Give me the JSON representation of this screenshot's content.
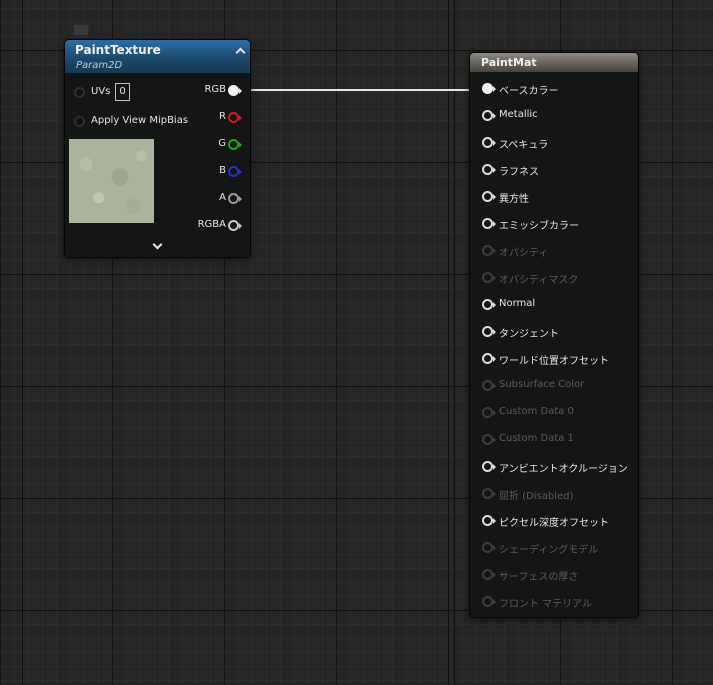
{
  "texture_node": {
    "title": "PaintTexture",
    "subtitle": "Param2D",
    "inputs": {
      "uvs_label": "UVs",
      "uvs_value": "0",
      "mip_label": "Apply View MipBias"
    },
    "outputs": {
      "rgb": "RGB",
      "r": "R",
      "g": "G",
      "b": "B",
      "a": "A",
      "rgba": "RGBA"
    },
    "colors": {
      "r": "#d81818",
      "g": "#1ea41e",
      "b": "#2030d0",
      "a": "#9a9a9a",
      "rgba": "#c8c8c8"
    }
  },
  "material_node": {
    "title": "PaintMat",
    "pins": [
      {
        "label": "ベースカラー",
        "enabled": true
      },
      {
        "label": "Metallic",
        "enabled": true
      },
      {
        "label": "スペキュラ",
        "enabled": true
      },
      {
        "label": "ラフネス",
        "enabled": true
      },
      {
        "label": "異方性",
        "enabled": true
      },
      {
        "label": "エミッシブカラー",
        "enabled": true
      },
      {
        "label": "オパシティ",
        "enabled": false
      },
      {
        "label": "オパシティマスク",
        "enabled": false
      },
      {
        "label": "Normal",
        "enabled": true
      },
      {
        "label": "タンジェント",
        "enabled": true
      },
      {
        "label": "ワールド位置オフセット",
        "enabled": true
      },
      {
        "label": "Subsurface Color",
        "enabled": false
      },
      {
        "label": "Custom Data 0",
        "enabled": false
      },
      {
        "label": "Custom Data 1",
        "enabled": false
      },
      {
        "label": "アンビエントオクルージョン",
        "enabled": true
      },
      {
        "label": "屈折 (Disabled)",
        "enabled": false
      },
      {
        "label": "ピクセル深度オフセット",
        "enabled": true
      },
      {
        "label": "シェーディングモデル",
        "enabled": false
      },
      {
        "label": "サーフェスの厚さ",
        "enabled": false
      },
      {
        "label": "フロント マテリアル",
        "enabled": false
      }
    ]
  }
}
